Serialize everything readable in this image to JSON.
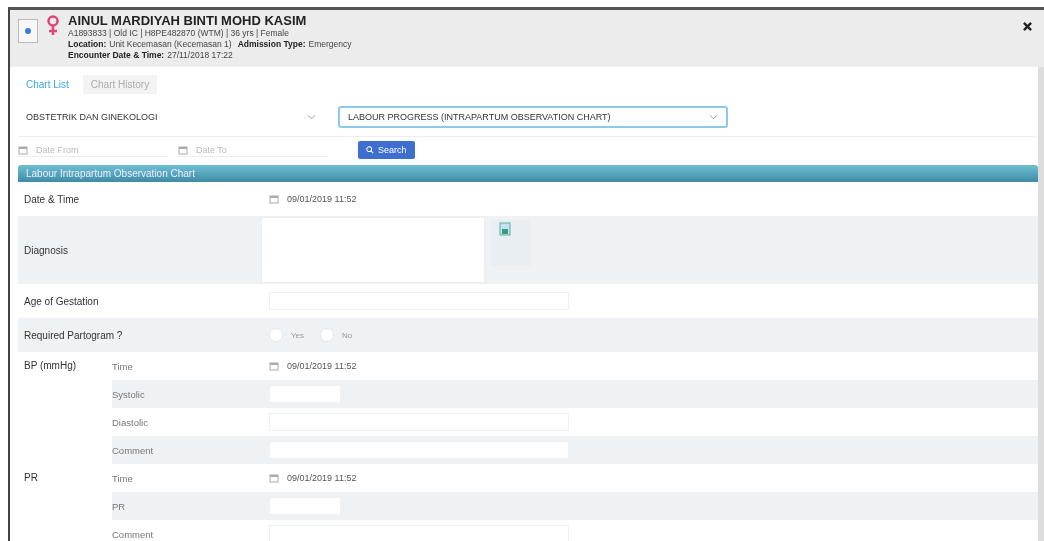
{
  "patient": {
    "name": "AINUL MARDIYAH BINTI MOHD KASIM",
    "ids": "A1893833 | Old IC | H8PE482870 (WTM) | 36 yrs | Female",
    "location_label": "Location:",
    "location": "Unit Kecemasan (Kecemasan 1)",
    "admission_label": "Admission Type:",
    "admission": "Emergency",
    "encounter_label": "Encounter Date & Time:",
    "encounter": "27/11/2018 17:22"
  },
  "tabs": [
    {
      "label": "Chart List",
      "selected": true
    },
    {
      "label": "Chart History",
      "selected": false
    }
  ],
  "filters": {
    "department": "OBSTETRIK DAN GINEKOLOGI",
    "chart": "LABOUR PROGRESS (INTRAPARTUM OBSERVATION CHART)",
    "date_from": {
      "placeholder": "Date From"
    },
    "date_to": {
      "placeholder": "Date To"
    },
    "search_button": "Search"
  },
  "section": {
    "title": "Labour Intrapartum Observation Chart"
  },
  "rows": [
    {
      "kind": "datetime",
      "label": "Date & Time",
      "value": "09/01/2019 11:52"
    },
    {
      "kind": "textarea",
      "label": "Diagnosis"
    },
    {
      "kind": "text",
      "label": "Age of Gestation"
    },
    {
      "kind": "radio",
      "label": "Required Partogram ?",
      "options": [
        {
          "label": "Yes",
          "selected": false
        },
        {
          "label": "No",
          "selected": false
        }
      ]
    },
    {
      "kind": "group",
      "label": "BP (mmHg)",
      "fields": [
        {
          "kind": "datetime",
          "label": "Time",
          "value": "09/01/2019 11:52"
        },
        {
          "kind": "short",
          "label": "Systolic"
        },
        {
          "kind": "text",
          "label": "Diastolic"
        },
        {
          "kind": "text",
          "label": "Comment"
        }
      ]
    },
    {
      "kind": "group",
      "label": "PR",
      "fields": [
        {
          "kind": "datetime",
          "label": "Time",
          "value": "09/01/2019 11:52"
        },
        {
          "kind": "short",
          "label": "PR"
        },
        {
          "kind": "text",
          "label": "Comment"
        }
      ]
    }
  ]
}
